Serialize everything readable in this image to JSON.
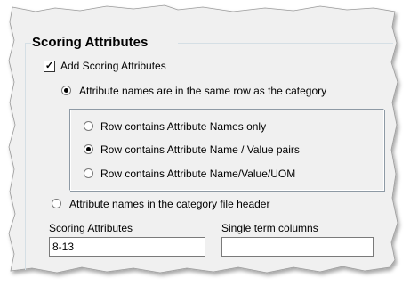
{
  "group": {
    "title": "Scoring Attributes"
  },
  "add_scoring": {
    "label": "Add Scoring Attributes",
    "checked": true
  },
  "radio_same_row": {
    "label": "Attribute names are in the same row as the category",
    "selected": true
  },
  "row_options": [
    {
      "label": "Row contains Attribute Names only",
      "selected": false
    },
    {
      "label": "Row contains Attribute Name / Value pairs",
      "selected": true
    },
    {
      "label": "Row contains Attribute Name/Value/UOM",
      "selected": false
    }
  ],
  "radio_header": {
    "label": "Attribute names in the category file header",
    "selected": false
  },
  "scoring_attributes_field": {
    "label": "Scoring Attributes",
    "value": "8-13"
  },
  "single_term_field": {
    "label": "Single term columns",
    "value": ""
  },
  "colors": {
    "panel_background": "#f0f0f0",
    "page_background": "#ffffff",
    "group_border": "#d5dfe5",
    "text": "#000000"
  }
}
